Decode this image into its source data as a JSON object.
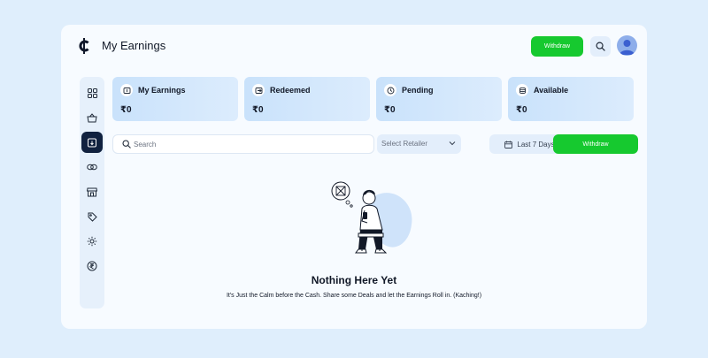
{
  "header": {
    "title": "My Earnings",
    "withdraw_label": "Withdraw"
  },
  "sidebar": {
    "items": [
      {
        "icon": "grid-icon"
      },
      {
        "icon": "basket-icon"
      },
      {
        "icon": "wallet-icon",
        "active": true
      },
      {
        "icon": "link-icon"
      },
      {
        "icon": "store-icon"
      },
      {
        "icon": "tag-icon"
      },
      {
        "icon": "gear-icon"
      },
      {
        "icon": "rupee-icon"
      }
    ]
  },
  "cards": [
    {
      "label": "My Earnings",
      "value": "₹0",
      "icon": "earnings-icon"
    },
    {
      "label": "Redeemed",
      "value": "₹0",
      "icon": "redeem-icon"
    },
    {
      "label": "Pending",
      "value": "₹0",
      "icon": "clock-icon"
    },
    {
      "label": "Available",
      "value": "₹0",
      "icon": "coins-icon"
    }
  ],
  "filters": {
    "search_placeholder": "Search",
    "retailer_placeholder": "Select Retailer",
    "date_label": "Last 7 Days",
    "withdraw_label": "Withdraw"
  },
  "empty_state": {
    "title": "Nothing Here Yet",
    "text": "It's Just the Calm before the Cash. Share some Deals and let the Earnings Roll in. (Kaching!)"
  },
  "colors": {
    "accent_green": "#16c92f",
    "active_nav": "#10213f",
    "card_bg": "#c9e2fb",
    "page_bg": "#dfeefc"
  }
}
